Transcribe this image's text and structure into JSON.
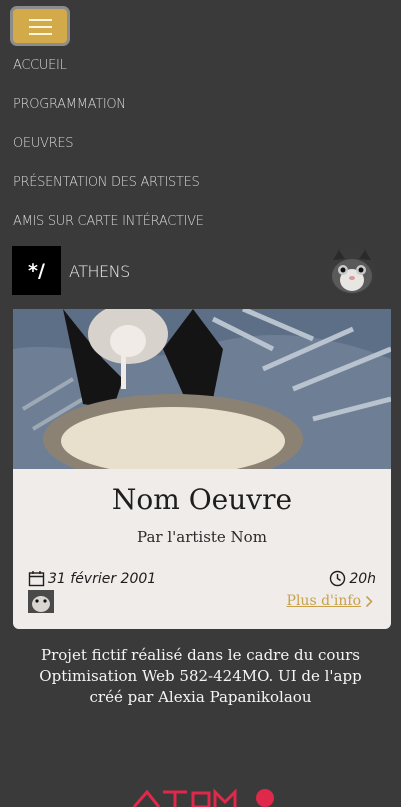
{
  "nav": {
    "menu_icon": "hamburger-icon",
    "items": [
      {
        "label": "ACCUEIL"
      },
      {
        "label": "PROGRAMMATION"
      },
      {
        "label": "OEUVRES"
      },
      {
        "label": "PRÉSENTATION DES ARTISTES"
      },
      {
        "label": "AMIS SUR CARTE INTÉRACTIVE"
      }
    ]
  },
  "brand": {
    "logo_text": "*/",
    "name": "ATHENS"
  },
  "card": {
    "title": "Nom Oeuvre",
    "artist": "Par l'artiste Nom",
    "date": "31 février 2001",
    "time": "20h",
    "more_link": "Plus d'info"
  },
  "footer": {
    "text": "Projet fictif réalisé dans le cadre du cours Optimisation Web 582-424MO. UI de l'app créé par Alexia Papanikolaou"
  },
  "colors": {
    "background": "#3a3a3a",
    "accent": "#d2aa4a",
    "card": "#f0ecea",
    "brand_red": "#e0284a"
  }
}
